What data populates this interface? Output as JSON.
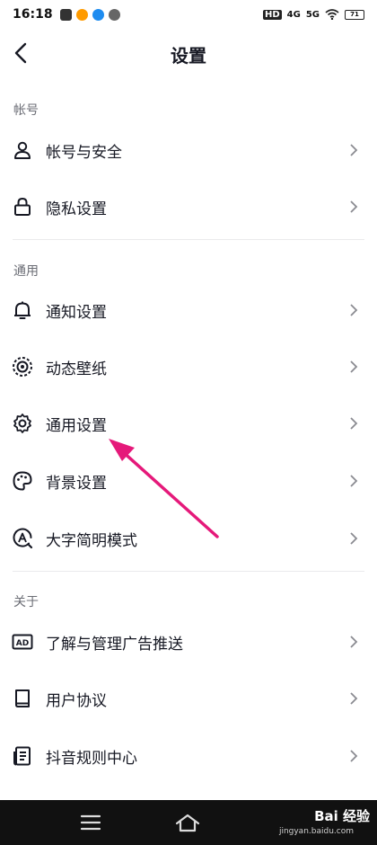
{
  "status": {
    "time": "16:18",
    "battery": "71",
    "net1": "4G",
    "net2": "5G",
    "hd": "HD"
  },
  "header": {
    "title": "设置"
  },
  "sections": {
    "account": {
      "title": "帐号",
      "items": [
        {
          "label": "帐号与安全",
          "icon": "user-icon"
        },
        {
          "label": "隐私设置",
          "icon": "lock-icon"
        }
      ]
    },
    "general": {
      "title": "通用",
      "items": [
        {
          "label": "通知设置",
          "icon": "bell-icon"
        },
        {
          "label": "动态壁纸",
          "icon": "live-wallpaper-icon"
        },
        {
          "label": "通用设置",
          "icon": "gear-icon"
        },
        {
          "label": "背景设置",
          "icon": "palette-icon"
        },
        {
          "label": "大字简明模式",
          "icon": "large-font-icon"
        }
      ]
    },
    "about": {
      "title": "关于",
      "items": [
        {
          "label": "了解与管理广告推送",
          "icon": "ad-icon"
        },
        {
          "label": "用户协议",
          "icon": "book-icon"
        },
        {
          "label": "抖音规则中心",
          "icon": "document-icon"
        }
      ]
    }
  },
  "annotation": {
    "arrow_color": "#e5197a"
  },
  "watermark": {
    "text": "Bai 经验",
    "sub": "jingyan.baidu.com"
  }
}
